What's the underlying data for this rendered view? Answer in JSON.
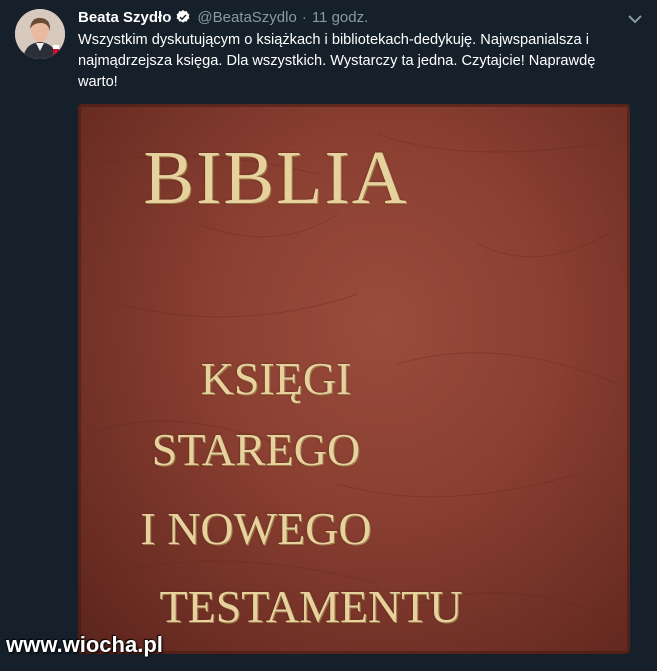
{
  "tweet": {
    "author_name": "Beata Szydło",
    "handle": "@BeataSzydlo",
    "separator": "·",
    "time": "11 godz.",
    "text": "Wszystkim dyskutującym o książkach i bibliotekach-dedykuję. Najwspanialsza i najmądrzejsza księga. Dla wszystkich. Wystarczy ta jedna. Czytajcie! Naprawdę warto!",
    "verified": true
  },
  "media": {
    "cover_title": "BIBLIA",
    "cover_lines": [
      "KSIĘGI",
      "STAREGO",
      "I NOWEGO",
      "TESTAMENTU"
    ]
  },
  "watermark": "www.wiocha.pl",
  "colors": {
    "background": "#15202b",
    "muted_text": "#8899a6",
    "verified_blue": "#1da1f2",
    "cover_leather": "#8a3f31",
    "gold_lettering": "#e7d29e"
  },
  "icons": {
    "verified": "verified-badge-icon",
    "menu": "chevron-down-icon"
  }
}
